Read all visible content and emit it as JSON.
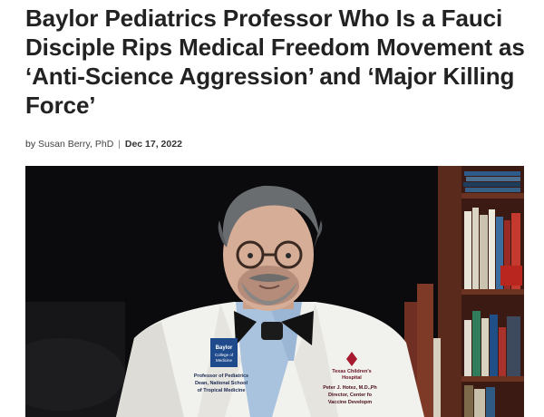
{
  "article": {
    "title": "Baylor Pediatrics Professor Who Is a Fauci Disciple Rips Medical Freedom Movement as ‘Anti-Science Aggression’ and ‘Major Killing Force’",
    "byline": {
      "prefix": "by",
      "author": "Susan Berry, PhD",
      "separator": "|",
      "date": "Dec 17, 2022"
    }
  },
  "photo": {
    "coat_patch_left": {
      "logo_line1": "Baylor",
      "logo_line2": "College of",
      "logo_line3": "Medicine",
      "line1": "Professor of Pediatrics",
      "line2": "Dean, National School",
      "line3": "of Tropical Medicine"
    },
    "coat_patch_right": {
      "logo_line1": "Texas Children's",
      "logo_line2": "Hospital",
      "line1": "Peter J. Hotez, M.D.,Ph",
      "line2": "Director, Center fo",
      "line3": "Vaccine Developm"
    },
    "colors": {
      "background": "#0b0b0d",
      "coat": "#f1f1ee",
      "shirt": "#a9c3df",
      "bowtie": "#121212",
      "bookshelf": "#5a2a1c"
    }
  }
}
